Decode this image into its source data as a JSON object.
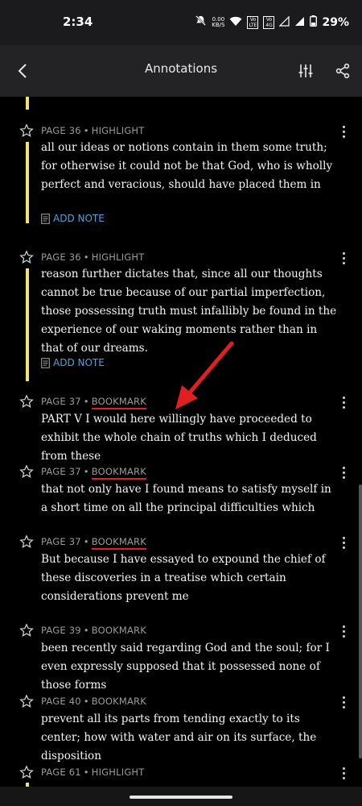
{
  "status": {
    "time": "2:34",
    "net_speed": "0.00",
    "net_unit": "KB/S",
    "sim1": "Vo LTE",
    "sim2": "Vo 4G",
    "battery": "29%"
  },
  "app_bar": {
    "title": "Annotations",
    "back_icon": "chevron-left-icon",
    "filter_icon": "sliders-icon",
    "share_icon": "share-icon"
  },
  "items": [
    {
      "page": "PAGE 36",
      "type": "HIGHLIGHT",
      "text": "all our ideas or notions contain in them some truth; for otherwise it could not be that God, who is wholly perfect and veracious, should have placed them in",
      "add_note": "ADD NOTE"
    },
    {
      "page": "PAGE 36",
      "type": "HIGHLIGHT",
      "text": "reason further dictates that, since all our thoughts cannot be true because of our partial imperfection, those possessing truth must infallibly be found in the experience of our waking moments rather than in that of our dreams.",
      "add_note": "ADD NOTE"
    },
    {
      "page": "PAGE 37",
      "type": "BOOKMARK",
      "text": "PART V I would here willingly have proceeded to exhibit the whole chain of truths which I deduced from these"
    },
    {
      "page": "PAGE 37",
      "type": "BOOKMARK",
      "text": "that not only have I found means to satisfy myself in a short time on all the principal difficulties which"
    },
    {
      "page": "PAGE 37",
      "type": "BOOKMARK",
      "text": "But because I have essayed to expound the chief of these discoveries in a treatise which certain considerations prevent me"
    },
    {
      "page": "PAGE 39",
      "type": "BOOKMARK",
      "text": "been recently said regarding God and the soul; for I even expressly supposed that it possessed none of those forms"
    },
    {
      "page": "PAGE 40",
      "type": "BOOKMARK",
      "text": "prevent all its parts from tending exactly to its center; how with water and air on its surface, the disposition"
    },
    {
      "page": "PAGE 61",
      "type": "HIGHLIGHT"
    }
  ],
  "colors": {
    "highlight": "#f2e36b",
    "link": "#4aa3df",
    "annotation_red": "#e02020"
  }
}
